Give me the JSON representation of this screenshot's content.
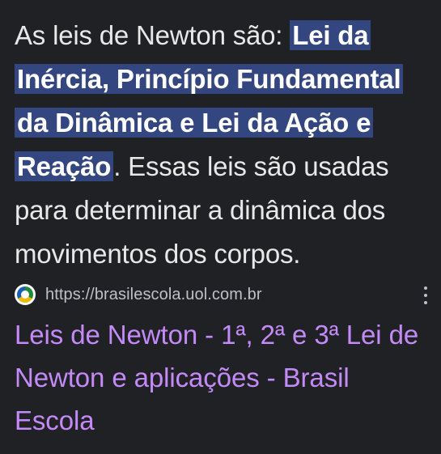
{
  "snippet": {
    "text_before": "As leis de Newton são: ",
    "highlight": "Lei da Inércia, Princípio Fundamental da Dinâmica e Lei da Ação e Reação",
    "text_after": ". Essas leis são usadas para determinar a dinâmica dos movimentos dos corpos."
  },
  "source": {
    "url": "https://brasilescola.uol.com.br",
    "favicon": "brasil-escola-globe-icon",
    "menu_icon": "more-vert-icon"
  },
  "result": {
    "title": "Leis de Newton - 1ª, 2ª e 3ª Lei de Newton e aplicações - Brasil Escola"
  },
  "colors": {
    "background": "#202124",
    "text": "#e8e8e8",
    "highlight_bg": "#34467f",
    "url_text": "#bdc1c6",
    "link": "#c58af9"
  }
}
